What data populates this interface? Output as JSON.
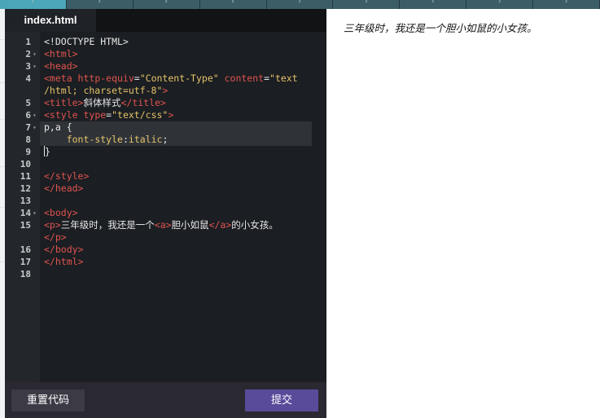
{
  "top_strip": {
    "segments": 9,
    "active_index": 0,
    "glyph": "›"
  },
  "editor": {
    "tab_label": "index.html",
    "active_line": 7,
    "lines": [
      {
        "n": "1",
        "fold": false,
        "html": "<span class='plain'>&lt;!DOCTYPE HTML&gt;</span>"
      },
      {
        "n": "2",
        "fold": true,
        "html": "<span class='tag'>&lt;html&gt;</span>"
      },
      {
        "n": "3",
        "fold": true,
        "html": "<span class='tag'>&lt;head&gt;</span>"
      },
      {
        "n": "4",
        "fold": false,
        "html": "<span class='tag'>&lt;meta </span><span class='attr'>http-equiv</span><span class='plain'>=</span><span class='str'>\"Content-Type\"</span><span class='plain'> </span><span class='attr'>content</span><span class='plain'>=</span><span class='str'>\"text</span>"
      },
      {
        "n": "",
        "fold": false,
        "html": "<span class='str'>/html; charset=utf-8\"</span><span class='tag'>&gt;</span>"
      },
      {
        "n": "5",
        "fold": false,
        "html": "<span class='tag'>&lt;title&gt;</span><span class='plain'>斜体样式</span><span class='tag'>&lt;/title&gt;</span>"
      },
      {
        "n": "6",
        "fold": true,
        "html": "<span class='tag'>&lt;style </span><span class='attr'>type</span><span class='plain'>=</span><span class='str'>\"text/css\"</span><span class='tag'>&gt;</span>"
      },
      {
        "n": "7",
        "fold": true,
        "html": "<span class='plain'>p,a {</span>"
      },
      {
        "n": "8",
        "fold": false,
        "html": "<span class='plain'>    </span><span class='prop'>font-style</span><span class='plain'>:</span><span class='prop'>italic</span><span class='plain'>;</span>"
      },
      {
        "n": "9",
        "fold": false,
        "html": "<span class='cursor'></span><span class='plain'>}</span>"
      },
      {
        "n": "10",
        "fold": false,
        "html": ""
      },
      {
        "n": "11",
        "fold": false,
        "html": "<span class='tag'>&lt;/style&gt;</span>"
      },
      {
        "n": "12",
        "fold": false,
        "html": "<span class='tag'>&lt;/head&gt;</span>"
      },
      {
        "n": "13",
        "fold": false,
        "html": ""
      },
      {
        "n": "14",
        "fold": true,
        "html": "<span class='tag'>&lt;body&gt;</span>"
      },
      {
        "n": "15",
        "fold": false,
        "html": "<span class='tag'>&lt;p&gt;</span><span class='plain'>三年级时，我还是一个</span><span class='tag'>&lt;a&gt;</span><span class='plain'>胆小如鼠</span><span class='tag'>&lt;/a&gt;</span><span class='plain'>的小女孩。</span>"
      },
      {
        "n": "",
        "fold": false,
        "html": "<span class='tag'>&lt;/p&gt;</span>"
      },
      {
        "n": "16",
        "fold": false,
        "html": "<span class='tag'>&lt;/body&gt;</span>"
      },
      {
        "n": "17",
        "fold": false,
        "html": "<span class='tag'>&lt;/html&gt;</span>"
      },
      {
        "n": "18",
        "fold": false,
        "html": ""
      }
    ],
    "reset_label": "重置代码",
    "submit_label": "提交"
  },
  "preview": {
    "text": "三年级时，我还是一个胆小如鼠的小女孩。"
  },
  "colors": {
    "tag": "#e0544f",
    "string": "#e6c36a",
    "submit_button": "#5a4a9a",
    "strip_active": "#4aa6b8"
  }
}
